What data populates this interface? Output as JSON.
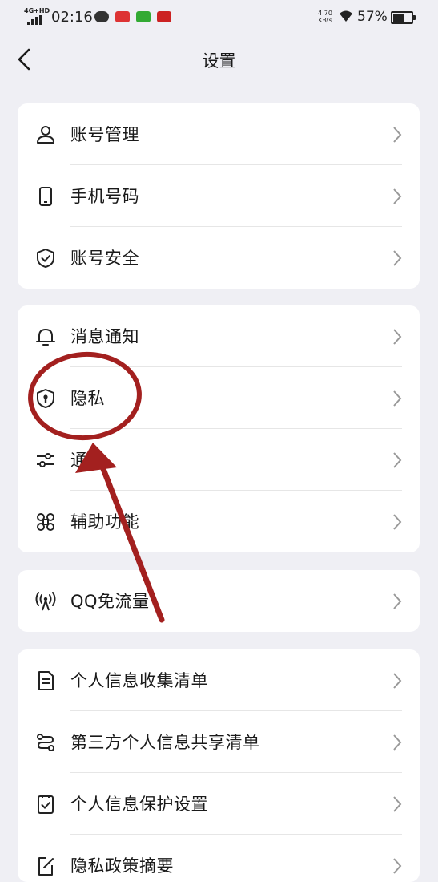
{
  "status_bar": {
    "network": "4G+HD",
    "time": "02:16",
    "speed_value": "4.70",
    "speed_unit": "KB/s",
    "battery": "57%"
  },
  "nav": {
    "title": "设置"
  },
  "groups": [
    {
      "items": [
        {
          "label": "账号管理",
          "icon": "person-icon"
        },
        {
          "label": "手机号码",
          "icon": "phone-icon"
        },
        {
          "label": "账号安全",
          "icon": "shield-check-icon"
        }
      ]
    },
    {
      "items": [
        {
          "label": "消息通知",
          "icon": "bell-icon"
        },
        {
          "label": "隐私",
          "icon": "privacy-shield-icon"
        },
        {
          "label": "通用",
          "icon": "sliders-icon"
        },
        {
          "label": "辅助功能",
          "icon": "command-icon"
        }
      ]
    },
    {
      "items": [
        {
          "label": "QQ免流量",
          "icon": "signal-tower-icon"
        }
      ]
    },
    {
      "items": [
        {
          "label": "个人信息收集清单",
          "icon": "document-list-icon"
        },
        {
          "label": "第三方个人信息共享清单",
          "icon": "share-flow-icon"
        },
        {
          "label": "个人信息保护设置",
          "icon": "checkbox-doc-icon"
        },
        {
          "label": "隐私政策摘要",
          "icon": "edit-doc-icon"
        }
      ]
    }
  ],
  "colors": {
    "annotation": "#a3201f",
    "background": "#efeff4",
    "card": "#ffffff"
  }
}
